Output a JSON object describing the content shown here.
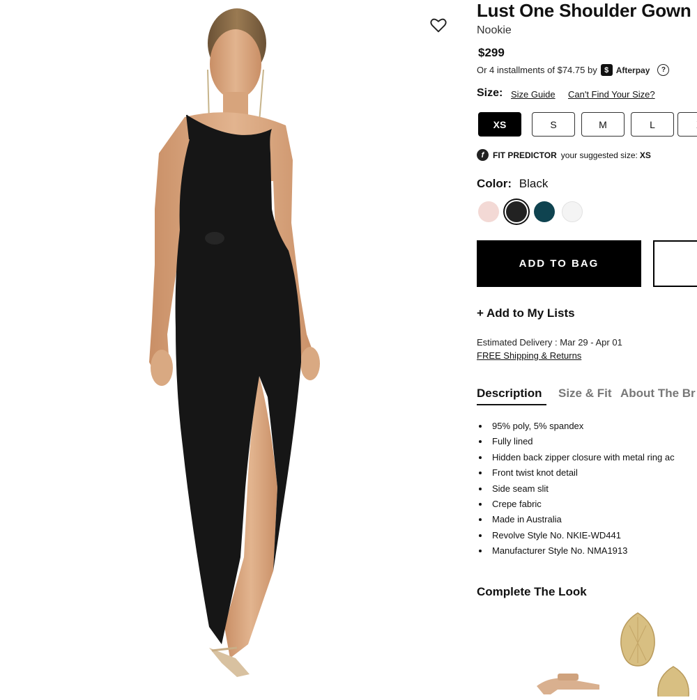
{
  "product": {
    "title": "Lust One Shoulder Gown",
    "brand": "Nookie",
    "price": "$299",
    "installments_text": "Or 4 installments of $74.75 by",
    "afterpay_logo_glyph": "$",
    "afterpay_label": "Afterpay",
    "help_glyph": "?"
  },
  "size": {
    "label": "Size:",
    "guide_link": "Size Guide",
    "cant_find_link": "Can't Find Your Size?",
    "options": [
      "XS",
      "S",
      "M",
      "L",
      "X"
    ],
    "selected": "XS"
  },
  "fit_predictor": {
    "icon_glyph": "f",
    "label": "FIT PREDICTOR",
    "suggestion_text": "your suggested size:",
    "suggested_size": "XS"
  },
  "color": {
    "label": "Color:",
    "selected_name": "Black",
    "swatches": [
      {
        "name": "blush",
        "hex": "#f3d9d5"
      },
      {
        "name": "black",
        "hex": "#222222"
      },
      {
        "name": "teal",
        "hex": "#0f4350"
      },
      {
        "name": "white",
        "hex": "#f4f4f4"
      }
    ]
  },
  "actions": {
    "add_to_bag": "ADD TO BAG",
    "add_to_lists": "+ Add to My Lists"
  },
  "delivery": {
    "estimate": "Estimated Delivery : Mar 29 - Apr 01",
    "free_shipping": "FREE Shipping & Returns"
  },
  "tabs": [
    {
      "label": "Description",
      "active": true
    },
    {
      "label": "Size & Fit",
      "active": false
    },
    {
      "label": "About The Br",
      "active": false
    }
  ],
  "details": [
    "95% poly, 5% spandex",
    "Fully lined",
    "Hidden back zipper closure with metal ring ac",
    "Front twist knot detail",
    "Side seam slit",
    "Crepe fabric",
    "Made in Australia",
    "Revolve Style No. NKIE-WD441",
    "Manufacturer Style No. NMA1913"
  ],
  "complete_the_look": "Complete The Look",
  "colors": {
    "primary": "#000000",
    "text": "#111111",
    "muted_tab": "#777777",
    "dress": "#161616",
    "skin": "#d9a982"
  }
}
